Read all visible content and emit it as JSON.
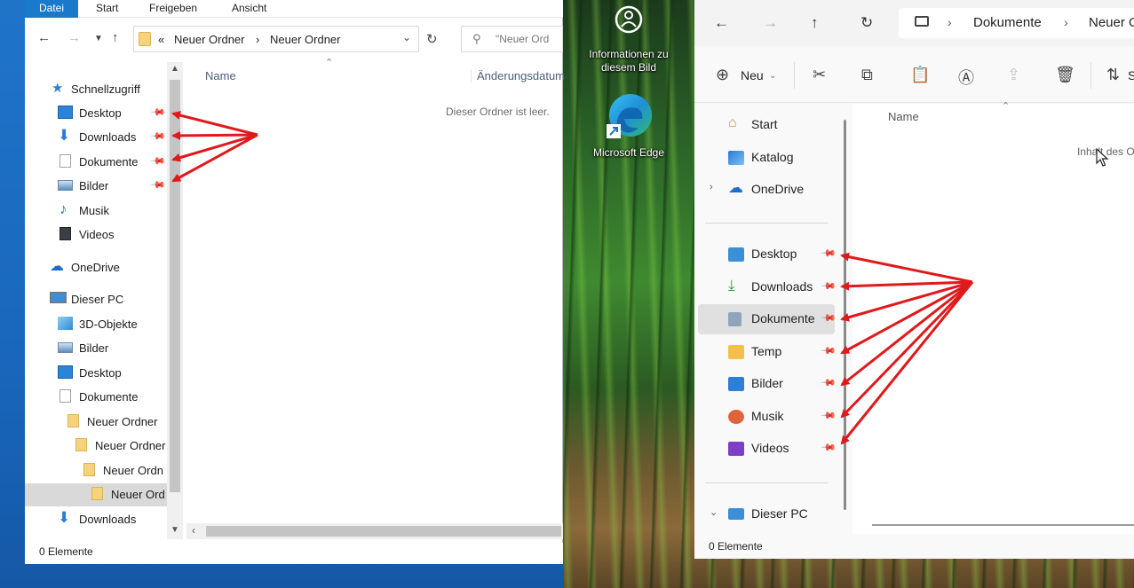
{
  "left_window": {
    "ribbon_tabs": [
      "Datei",
      "Start",
      "Freigeben",
      "Ansicht"
    ],
    "address": {
      "prefix": "«",
      "crumbs": [
        "Neuer Ordner",
        "Neuer Ordner"
      ],
      "separator": "›"
    },
    "search_placeholder": "\"Neuer Ord",
    "nav": {
      "quick_access": "Schnellzugriff",
      "items": [
        {
          "label": "Desktop",
          "pinned": true
        },
        {
          "label": "Downloads",
          "pinned": true
        },
        {
          "label": "Dokumente",
          "pinned": true
        },
        {
          "label": "Bilder",
          "pinned": true
        },
        {
          "label": "Musik",
          "pinned": false
        },
        {
          "label": "Videos",
          "pinned": false
        }
      ],
      "onedrive": "OneDrive",
      "this_pc": "Dieser PC",
      "pc_items": [
        "3D-Objekte",
        "Bilder",
        "Desktop",
        "Dokumente"
      ],
      "tree": [
        "Neuer Ordner",
        "Neuer Ordner",
        "Neuer Ordn",
        "Neuer Ord"
      ],
      "after": "Downloads"
    },
    "columns": {
      "name": "Name",
      "modified": "Änderungsdatum"
    },
    "empty_text": "Dieser Ordner ist leer.",
    "status": "0 Elemente"
  },
  "desktop_icons": [
    {
      "label": "Informationen zu diesem Bild",
      "icon": "info-icon"
    },
    {
      "label": "Microsoft Edge",
      "icon": "edge-icon"
    }
  ],
  "right_window": {
    "address": {
      "crumbs": [
        "Dokumente",
        "Neuer O"
      ],
      "separator": "›"
    },
    "command_bar": {
      "new_label": "Neu",
      "sort_label": "S"
    },
    "nav": {
      "top": [
        {
          "label": "Start",
          "icon": "home-icon"
        },
        {
          "label": "Katalog",
          "icon": "gallery-icon"
        },
        {
          "label": "OneDrive",
          "icon": "onedrive-icon"
        }
      ],
      "pinned": [
        {
          "label": "Desktop",
          "color": "#3a8fd6"
        },
        {
          "label": "Downloads",
          "color": "#2ea44f"
        },
        {
          "label": "Dokumente",
          "color": "#8fa5bd"
        },
        {
          "label": "Temp",
          "color": "#f3c14b"
        },
        {
          "label": "Bilder",
          "color": "#2f7fd8"
        },
        {
          "label": "Musik",
          "color": "#e0643a"
        },
        {
          "label": "Videos",
          "color": "#7e3fc8"
        }
      ],
      "this_pc": "Dieser PC"
    },
    "column_name": "Name",
    "empty_text": "Inhalt des O",
    "status": "0 Elemente"
  },
  "colors": {
    "accent": "#1979ca",
    "arrow": "#e0191b"
  }
}
